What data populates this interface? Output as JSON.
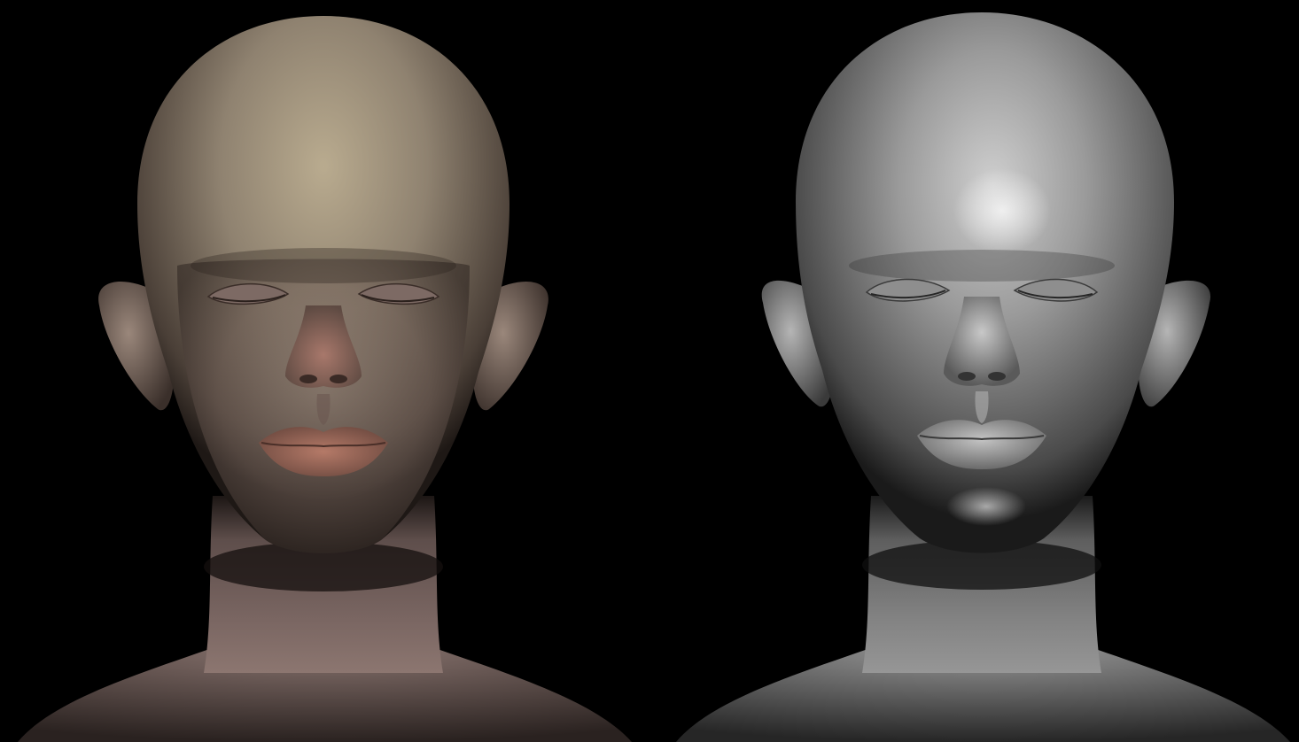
{
  "scene": {
    "background_color": "#000000",
    "layout": "side-by-side",
    "panels": [
      {
        "id": "textured-render",
        "subject": "bald-head-sculpt",
        "material": "skin-texture",
        "eyes": "closed",
        "colors": {
          "skin_base": "#8f7f70",
          "skin_highlight": "#b8a98e",
          "skin_shadow": "#3b302b",
          "lips": "#a8705f",
          "nose_tint": "#a06e62",
          "neck": "#7a6660"
        }
      },
      {
        "id": "clay-render",
        "subject": "bald-head-sculpt",
        "material": "grey-clay",
        "eyes": "closed",
        "colors": {
          "clay_base": "#8c8c8c",
          "clay_highlight": "#d8d8d8",
          "clay_shadow": "#2a2a2a",
          "specular": "#f2f2f2"
        }
      }
    ]
  }
}
